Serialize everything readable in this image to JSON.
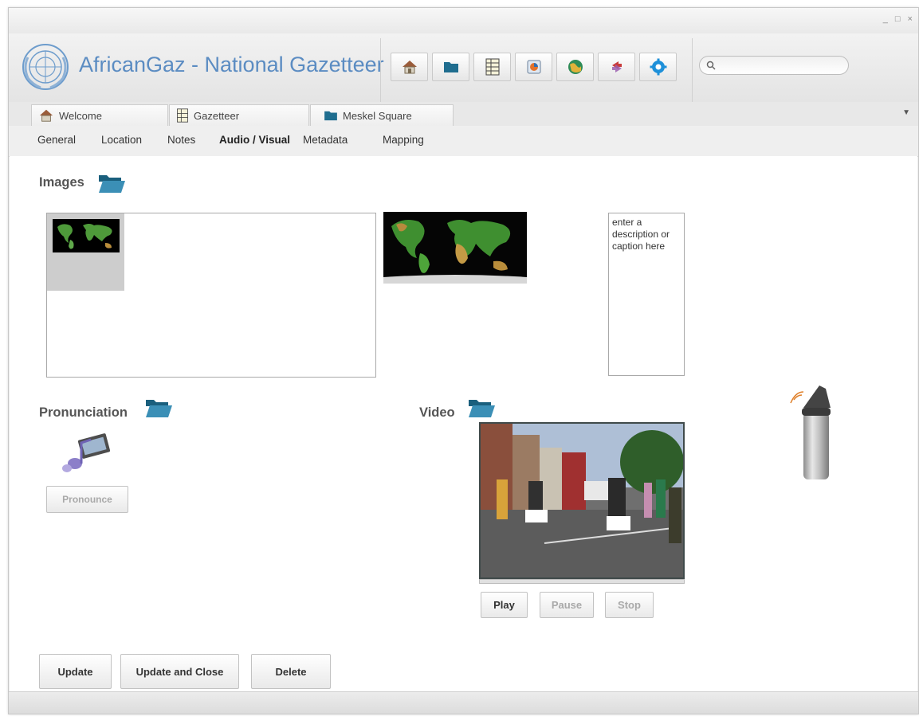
{
  "window": {
    "controls": "_ □ ×"
  },
  "app": {
    "title": "AfricanGaz - National Gazetteer"
  },
  "toolbar": {
    "buttons": [
      {
        "icon": "home-icon"
      },
      {
        "icon": "folder-icon"
      },
      {
        "icon": "gazetteer-table-icon"
      },
      {
        "icon": "chart-icon"
      },
      {
        "icon": "globe-icon"
      },
      {
        "icon": "sync-icon"
      },
      {
        "icon": "settings-gear-icon"
      }
    ]
  },
  "search": {
    "placeholder": "",
    "value": ""
  },
  "tabs": [
    {
      "label": "Welcome",
      "icon": "home-icon"
    },
    {
      "label": "Gazetteer",
      "icon": "gazetteer-table-icon"
    },
    {
      "label": "Meskel Square",
      "icon": "folder-icon"
    }
  ],
  "subtabs": [
    {
      "label": "General"
    },
    {
      "label": "Location"
    },
    {
      "label": "Notes"
    },
    {
      "label": "Audio / Visual",
      "active": true
    },
    {
      "label": "Metadata"
    },
    {
      "label": "Mapping"
    }
  ],
  "images": {
    "label": "Images",
    "description": "enter a description or caption here"
  },
  "pronunciation": {
    "label": "Pronunciation",
    "button": "Pronounce"
  },
  "video": {
    "label": "Video",
    "play": "Play",
    "pause": "Pause",
    "stop": "Stop"
  },
  "actions": {
    "update": "Update",
    "update_close": "Update and Close",
    "delete": "Delete"
  },
  "colors": {
    "title_blue": "#5b8cc2",
    "folder_blue": "#2a7fa3"
  }
}
